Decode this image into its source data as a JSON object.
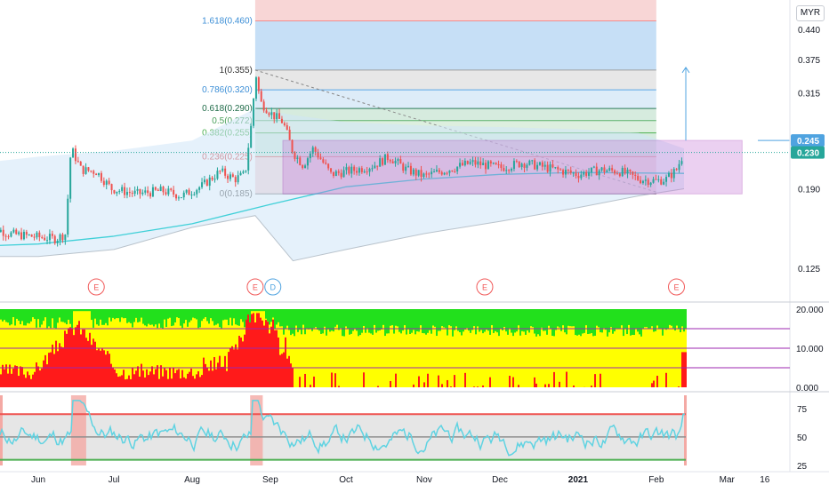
{
  "currency": "MYR",
  "chart_data": [
    {
      "type": "candlestick",
      "panel": "price",
      "y_scale": "log",
      "y_ticks": [
        "0.440",
        "0.375",
        "0.315",
        "0.190",
        "0.125"
      ],
      "y_tick_values": [
        0.44,
        0.375,
        0.315,
        0.19,
        0.125
      ],
      "ylim": [
        0.108,
        0.48
      ],
      "x_ticks": [
        "Jun",
        "Jul",
        "Aug",
        "Sep",
        "Oct",
        "Nov",
        "Dec",
        "2021",
        "Feb",
        "Mar",
        "16"
      ],
      "x_tick_dates": [
        "2020-06-01",
        "2020-07-01",
        "2020-08-01",
        "2020-09-01",
        "2020-10-01",
        "2020-11-01",
        "2020-12-01",
        "2021-01-01",
        "2021-02-01",
        "2021-03-01",
        "2021-03-16"
      ],
      "close_path": [
        [
          "2020-05-11",
          0.158
        ],
        [
          "2020-05-20",
          0.15
        ],
        [
          "2020-05-29",
          0.148
        ],
        [
          "2020-06-08",
          0.146
        ],
        [
          "2020-06-12",
          0.15
        ],
        [
          "2020-06-14",
          0.235
        ],
        [
          "2020-06-18",
          0.21
        ],
        [
          "2020-06-24",
          0.208
        ],
        [
          "2020-06-30",
          0.19
        ],
        [
          "2020-07-10",
          0.185
        ],
        [
          "2020-07-20",
          0.188
        ],
        [
          "2020-07-28",
          0.183
        ],
        [
          "2020-08-05",
          0.193
        ],
        [
          "2020-08-12",
          0.208
        ],
        [
          "2020-08-18",
          0.2
        ],
        [
          "2020-08-22",
          0.205
        ],
        [
          "2020-08-25",
          0.28
        ],
        [
          "2020-08-26",
          0.355
        ],
        [
          "2020-08-28",
          0.3
        ],
        [
          "2020-09-02",
          0.28
        ],
        [
          "2020-09-06",
          0.27
        ],
        [
          "2020-09-10",
          0.23
        ],
        [
          "2020-09-14",
          0.215
        ],
        [
          "2020-09-18",
          0.235
        ],
        [
          "2020-09-25",
          0.205
        ],
        [
          "2020-10-05",
          0.21
        ],
        [
          "2020-10-12",
          0.215
        ],
        [
          "2020-10-18",
          0.225
        ],
        [
          "2020-10-25",
          0.21
        ],
        [
          "2020-11-01",
          0.203
        ],
        [
          "2020-11-10",
          0.21
        ],
        [
          "2020-11-20",
          0.218
        ],
        [
          "2020-12-01",
          0.212
        ],
        [
          "2020-12-10",
          0.218
        ],
        [
          "2020-12-20",
          0.212
        ],
        [
          "2021-01-01",
          0.205
        ],
        [
          "2021-01-10",
          0.21
        ],
        [
          "2021-01-18",
          0.208
        ],
        [
          "2021-01-25",
          0.2
        ],
        [
          "2021-02-01",
          0.198
        ],
        [
          "2021-02-05",
          0.2
        ],
        [
          "2021-02-09",
          0.21
        ],
        [
          "2021-02-12",
          0.23
        ]
      ],
      "last_price": "0.230",
      "target_price": "0.245",
      "fibonacci": {
        "levels": [
          {
            "label": "1.618(0.460)",
            "value": 0.46
          },
          {
            "label": "1(0.355)",
            "value": 0.355
          },
          {
            "label": "0.786(0.320)",
            "value": 0.32
          },
          {
            "label": "0.618(0.290)",
            "value": 0.29
          },
          {
            "label": "0.5(0.272)",
            "value": 0.272
          },
          {
            "label": "0.382(0.255)",
            "value": 0.255
          },
          {
            "label": "0.236(0.225)",
            "value": 0.225
          },
          {
            "label": "0(0.185)",
            "value": 0.185
          }
        ],
        "date_range": [
          "2020-08-26",
          "2021-02-01"
        ]
      },
      "range_box": {
        "date_range": [
          "2020-09-06",
          "2021-03-07"
        ],
        "price_range": [
          0.185,
          0.245
        ]
      },
      "event_markers": [
        {
          "label": "E",
          "date": "2020-06-24",
          "color": "#f15a5a"
        },
        {
          "label": "E",
          "date": "2020-08-26",
          "color": "#f15a5a"
        },
        {
          "label": "D",
          "date": "2020-09-02",
          "color": "#4fa3e0"
        },
        {
          "label": "E",
          "date": "2020-11-25",
          "color": "#f15a5a"
        },
        {
          "label": "E",
          "date": "2021-02-09",
          "color": "#f15a5a"
        }
      ]
    },
    {
      "type": "area",
      "panel": "volume-pressure",
      "y_ticks": [
        "20.000",
        "10.000",
        "0.000"
      ],
      "y_tick_values": [
        20,
        10,
        0
      ],
      "ylim": [
        0,
        20
      ],
      "reference_lines": [
        15,
        10,
        5
      ],
      "bands": {
        "colors": [
          "#ff1a1a",
          "#ffff00",
          "#22e01c"
        ]
      }
    },
    {
      "type": "line",
      "panel": "rsi",
      "y_ticks": [
        "75",
        "50",
        "25"
      ],
      "y_tick_values": [
        75,
        50,
        25
      ],
      "ylim": [
        25,
        85
      ],
      "overbought": 70,
      "oversold": 30
    }
  ]
}
